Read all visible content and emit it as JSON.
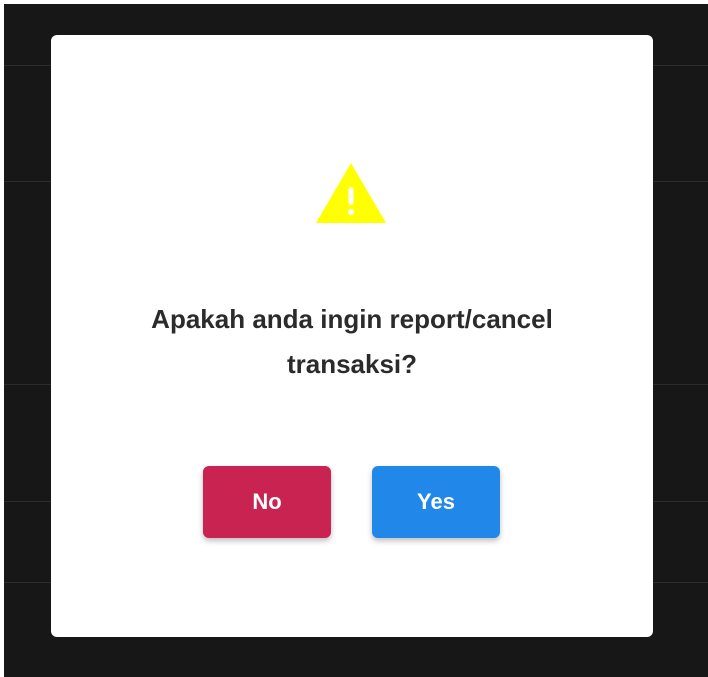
{
  "dialog": {
    "message": "Apakah anda ingin report/cancel transaksi?",
    "icon": "warning-icon",
    "buttons": {
      "no_label": "No",
      "yes_label": "Yes"
    }
  },
  "colors": {
    "overlay": "#171717",
    "modal_background": "#ffffff",
    "warning_icon": "#ffff00",
    "no_button": "#c92351",
    "yes_button": "#2187e8",
    "message_text": "#2b2b2b"
  }
}
